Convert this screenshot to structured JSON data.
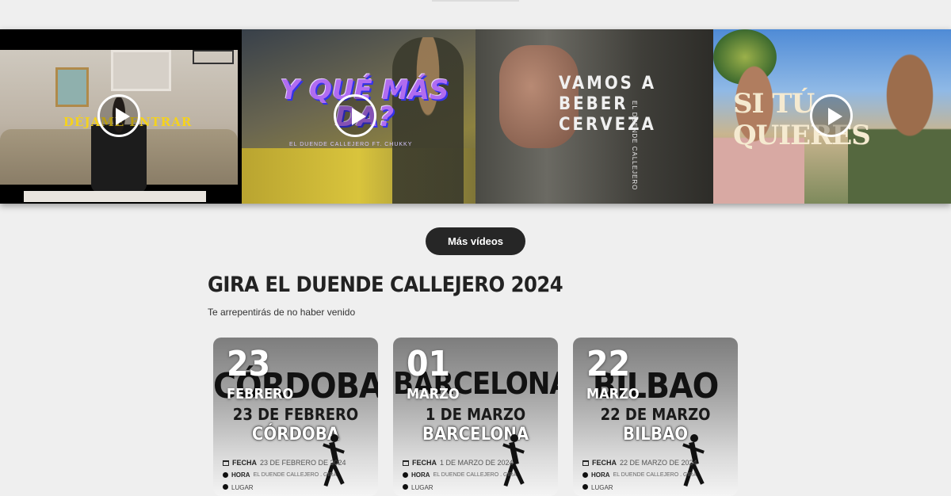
{
  "videos": [
    {
      "title": "DÉJAME ENTRAR",
      "subtitle": ""
    },
    {
      "title": "Y QUÉ MÁS DA?",
      "subtitle": "EL DUENDE CALLEJERO FT. CHUKKY"
    },
    {
      "title_lines": [
        "VAMOS A",
        "BEBER",
        "CERVEZA"
      ],
      "subtitle": "EL DUENDE CALLEJERO"
    },
    {
      "title": "SI TÚ QUIERES",
      "subtitle": ""
    }
  ],
  "more_videos_label": "Más vídeos",
  "tour": {
    "title": "GIRA EL DUENDE CALLEJERO 2024",
    "subtitle": "Te arrepentirás de no haber venido",
    "cards": [
      {
        "day": "23",
        "month": "FEBRERO",
        "big_city": "CÓRDOBA",
        "date_line": "23 DE FEBRERO",
        "city_line": "CÓRDOBA",
        "fecha_label": "FECHA",
        "fecha_value": "23 DE FEBRERO DE 2024",
        "hora_label": "HORA",
        "hora_meta": "EL DUENDE CALLEJERO . GIRA",
        "lugar": "LUGAR"
      },
      {
        "day": "01",
        "month": "MARZO",
        "big_city": "BARCELONA",
        "date_line": "1 DE MARZO",
        "city_line": "BARCELONA",
        "fecha_label": "FECHA",
        "fecha_value": "1 DE MARZO DE 2024",
        "hora_label": "HORA",
        "hora_meta": "EL DUENDE CALLEJERO . GIRA",
        "lugar": "LUGAR"
      },
      {
        "day": "22",
        "month": "MARZO",
        "big_city": "BILBAO",
        "date_line": "22 DE MARZO",
        "city_line": "BILBAO",
        "fecha_label": "FECHA",
        "fecha_value": "22 DE MARZO DE 2024",
        "hora_label": "HORA",
        "hora_meta": "EL DUENDE CALLEJERO . GIRA",
        "lugar": "LUGAR"
      }
    ]
  },
  "icons": {
    "play": "play-icon",
    "calendar": "calendar-icon",
    "clock": "clock-icon",
    "location": "location-icon"
  }
}
